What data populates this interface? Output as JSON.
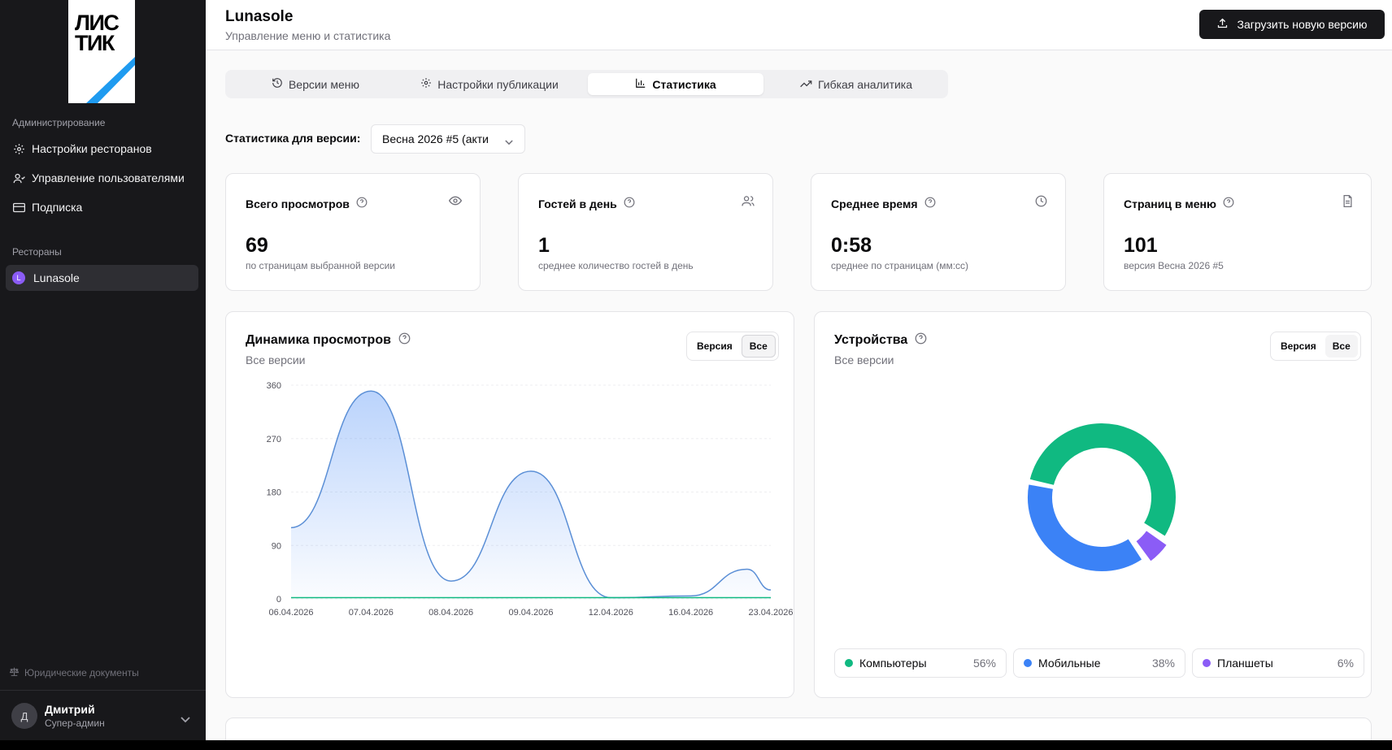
{
  "sidebar": {
    "logo_text": "ЛИС\nТИК",
    "section_admin": "Администрирование",
    "admin_items": [
      {
        "label": "Настройки ресторанов",
        "icon": "gear-icon"
      },
      {
        "label": "Управление пользователями",
        "icon": "users-icon"
      },
      {
        "label": "Подписка",
        "icon": "card-icon"
      }
    ],
    "section_restaurants": "Рестораны",
    "restaurant": {
      "label": "Lunasole",
      "badge": "L",
      "badge_color": "#8b5cf6"
    },
    "legal": "Юридические документы",
    "user": {
      "initial": "Д",
      "name": "Дмитрий",
      "role": "Супер-админ"
    }
  },
  "header": {
    "title": "Lunasole",
    "subtitle": "Управление меню и статистика",
    "upload_label": "Загрузить новую версию"
  },
  "tabs": [
    {
      "label": "Версии меню",
      "icon": "history-icon",
      "active": false
    },
    {
      "label": "Настройки публикации",
      "icon": "gear-icon",
      "active": false
    },
    {
      "label": "Статистика",
      "icon": "bar-chart-icon",
      "active": true
    },
    {
      "label": "Гибкая аналитика",
      "icon": "trend-icon",
      "active": false
    }
  ],
  "version_filter": {
    "label": "Статистика для версии:",
    "value": "Весна 2026 #5 (акти"
  },
  "stats": [
    {
      "title": "Всего просмотров",
      "icon": "eye-icon",
      "value": "69",
      "desc": "по страницам выбранной версии"
    },
    {
      "title": "Гостей в день",
      "icon": "users-icon",
      "value": "1",
      "desc": "среднее количество гостей в день"
    },
    {
      "title": "Среднее время",
      "icon": "clock-icon",
      "value": "0:58",
      "desc": "среднее по страницам (мм:сс)"
    },
    {
      "title": "Страниц в меню",
      "icon": "document-icon",
      "value": "101",
      "desc": "версия Весна 2026 #5"
    }
  ],
  "views_card": {
    "title": "Динамика просмотров",
    "subtitle": "Все версии",
    "toggle": [
      "Версия",
      "Все"
    ],
    "toggle_selected": "Все"
  },
  "devices_card": {
    "title": "Устройства",
    "subtitle": "Все версии",
    "toggle": [
      "Версия",
      "Все"
    ],
    "toggle_selected": "Все",
    "legend": [
      {
        "label": "Компьютеры",
        "pct": "56%",
        "color": "#10b981"
      },
      {
        "label": "Мобильные",
        "pct": "38%",
        "color": "#3b82f6"
      },
      {
        "label": "Планшеты",
        "pct": "6%",
        "color": "#8b5cf6"
      }
    ]
  },
  "chart_data": [
    {
      "type": "area",
      "categories": [
        "06.04.2026",
        "07.04.2026",
        "08.04.2026",
        "09.04.2026",
        "12.04.2026",
        "16.04.2026",
        "23.04.2026"
      ],
      "series": [
        {
          "values": [
            120,
            350,
            30,
            215,
            2,
            5,
            15
          ],
          "color": "#5b8fd6"
        },
        {
          "values": [
            2,
            2,
            2,
            2,
            2,
            2,
            2
          ],
          "color": "#10b981"
        }
      ],
      "extra_points": [
        {
          "between": [
            "16.04.2026",
            "23.04.2026"
          ],
          "y": 50
        }
      ],
      "yticks": [
        0,
        90,
        180,
        270,
        360
      ],
      "ylim": [
        0,
        360
      ],
      "grid": true
    },
    {
      "type": "pie",
      "donut": true,
      "labels": [
        "Компьютеры",
        "Мобильные",
        "Планшеты"
      ],
      "values": [
        56,
        38,
        6
      ],
      "colors": [
        "#10b981",
        "#3b82f6",
        "#8b5cf6"
      ]
    }
  ]
}
